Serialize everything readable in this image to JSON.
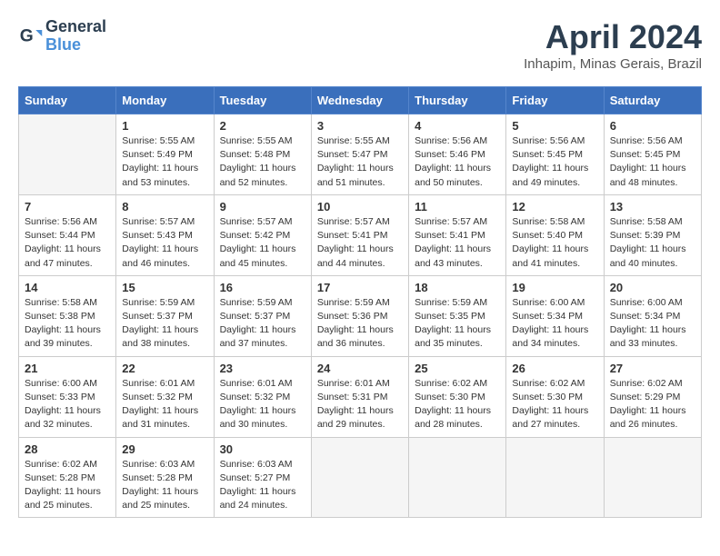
{
  "header": {
    "logo_line1": "General",
    "logo_line2": "Blue",
    "month_year": "April 2024",
    "location": "Inhapim, Minas Gerais, Brazil"
  },
  "days_of_week": [
    "Sunday",
    "Monday",
    "Tuesday",
    "Wednesday",
    "Thursday",
    "Friday",
    "Saturday"
  ],
  "weeks": [
    [
      {
        "num": "",
        "sunrise": "",
        "sunset": "",
        "daylight": ""
      },
      {
        "num": "1",
        "sunrise": "Sunrise: 5:55 AM",
        "sunset": "Sunset: 5:49 PM",
        "daylight": "Daylight: 11 hours and 53 minutes."
      },
      {
        "num": "2",
        "sunrise": "Sunrise: 5:55 AM",
        "sunset": "Sunset: 5:48 PM",
        "daylight": "Daylight: 11 hours and 52 minutes."
      },
      {
        "num": "3",
        "sunrise": "Sunrise: 5:55 AM",
        "sunset": "Sunset: 5:47 PM",
        "daylight": "Daylight: 11 hours and 51 minutes."
      },
      {
        "num": "4",
        "sunrise": "Sunrise: 5:56 AM",
        "sunset": "Sunset: 5:46 PM",
        "daylight": "Daylight: 11 hours and 50 minutes."
      },
      {
        "num": "5",
        "sunrise": "Sunrise: 5:56 AM",
        "sunset": "Sunset: 5:45 PM",
        "daylight": "Daylight: 11 hours and 49 minutes."
      },
      {
        "num": "6",
        "sunrise": "Sunrise: 5:56 AM",
        "sunset": "Sunset: 5:45 PM",
        "daylight": "Daylight: 11 hours and 48 minutes."
      }
    ],
    [
      {
        "num": "7",
        "sunrise": "Sunrise: 5:56 AM",
        "sunset": "Sunset: 5:44 PM",
        "daylight": "Daylight: 11 hours and 47 minutes."
      },
      {
        "num": "8",
        "sunrise": "Sunrise: 5:57 AM",
        "sunset": "Sunset: 5:43 PM",
        "daylight": "Daylight: 11 hours and 46 minutes."
      },
      {
        "num": "9",
        "sunrise": "Sunrise: 5:57 AM",
        "sunset": "Sunset: 5:42 PM",
        "daylight": "Daylight: 11 hours and 45 minutes."
      },
      {
        "num": "10",
        "sunrise": "Sunrise: 5:57 AM",
        "sunset": "Sunset: 5:41 PM",
        "daylight": "Daylight: 11 hours and 44 minutes."
      },
      {
        "num": "11",
        "sunrise": "Sunrise: 5:57 AM",
        "sunset": "Sunset: 5:41 PM",
        "daylight": "Daylight: 11 hours and 43 minutes."
      },
      {
        "num": "12",
        "sunrise": "Sunrise: 5:58 AM",
        "sunset": "Sunset: 5:40 PM",
        "daylight": "Daylight: 11 hours and 41 minutes."
      },
      {
        "num": "13",
        "sunrise": "Sunrise: 5:58 AM",
        "sunset": "Sunset: 5:39 PM",
        "daylight": "Daylight: 11 hours and 40 minutes."
      }
    ],
    [
      {
        "num": "14",
        "sunrise": "Sunrise: 5:58 AM",
        "sunset": "Sunset: 5:38 PM",
        "daylight": "Daylight: 11 hours and 39 minutes."
      },
      {
        "num": "15",
        "sunrise": "Sunrise: 5:59 AM",
        "sunset": "Sunset: 5:37 PM",
        "daylight": "Daylight: 11 hours and 38 minutes."
      },
      {
        "num": "16",
        "sunrise": "Sunrise: 5:59 AM",
        "sunset": "Sunset: 5:37 PM",
        "daylight": "Daylight: 11 hours and 37 minutes."
      },
      {
        "num": "17",
        "sunrise": "Sunrise: 5:59 AM",
        "sunset": "Sunset: 5:36 PM",
        "daylight": "Daylight: 11 hours and 36 minutes."
      },
      {
        "num": "18",
        "sunrise": "Sunrise: 5:59 AM",
        "sunset": "Sunset: 5:35 PM",
        "daylight": "Daylight: 11 hours and 35 minutes."
      },
      {
        "num": "19",
        "sunrise": "Sunrise: 6:00 AM",
        "sunset": "Sunset: 5:34 PM",
        "daylight": "Daylight: 11 hours and 34 minutes."
      },
      {
        "num": "20",
        "sunrise": "Sunrise: 6:00 AM",
        "sunset": "Sunset: 5:34 PM",
        "daylight": "Daylight: 11 hours and 33 minutes."
      }
    ],
    [
      {
        "num": "21",
        "sunrise": "Sunrise: 6:00 AM",
        "sunset": "Sunset: 5:33 PM",
        "daylight": "Daylight: 11 hours and 32 minutes."
      },
      {
        "num": "22",
        "sunrise": "Sunrise: 6:01 AM",
        "sunset": "Sunset: 5:32 PM",
        "daylight": "Daylight: 11 hours and 31 minutes."
      },
      {
        "num": "23",
        "sunrise": "Sunrise: 6:01 AM",
        "sunset": "Sunset: 5:32 PM",
        "daylight": "Daylight: 11 hours and 30 minutes."
      },
      {
        "num": "24",
        "sunrise": "Sunrise: 6:01 AM",
        "sunset": "Sunset: 5:31 PM",
        "daylight": "Daylight: 11 hours and 29 minutes."
      },
      {
        "num": "25",
        "sunrise": "Sunrise: 6:02 AM",
        "sunset": "Sunset: 5:30 PM",
        "daylight": "Daylight: 11 hours and 28 minutes."
      },
      {
        "num": "26",
        "sunrise": "Sunrise: 6:02 AM",
        "sunset": "Sunset: 5:30 PM",
        "daylight": "Daylight: 11 hours and 27 minutes."
      },
      {
        "num": "27",
        "sunrise": "Sunrise: 6:02 AM",
        "sunset": "Sunset: 5:29 PM",
        "daylight": "Daylight: 11 hours and 26 minutes."
      }
    ],
    [
      {
        "num": "28",
        "sunrise": "Sunrise: 6:02 AM",
        "sunset": "Sunset: 5:28 PM",
        "daylight": "Daylight: 11 hours and 25 minutes."
      },
      {
        "num": "29",
        "sunrise": "Sunrise: 6:03 AM",
        "sunset": "Sunset: 5:28 PM",
        "daylight": "Daylight: 11 hours and 25 minutes."
      },
      {
        "num": "30",
        "sunrise": "Sunrise: 6:03 AM",
        "sunset": "Sunset: 5:27 PM",
        "daylight": "Daylight: 11 hours and 24 minutes."
      },
      {
        "num": "",
        "sunrise": "",
        "sunset": "",
        "daylight": ""
      },
      {
        "num": "",
        "sunrise": "",
        "sunset": "",
        "daylight": ""
      },
      {
        "num": "",
        "sunrise": "",
        "sunset": "",
        "daylight": ""
      },
      {
        "num": "",
        "sunrise": "",
        "sunset": "",
        "daylight": ""
      }
    ]
  ]
}
